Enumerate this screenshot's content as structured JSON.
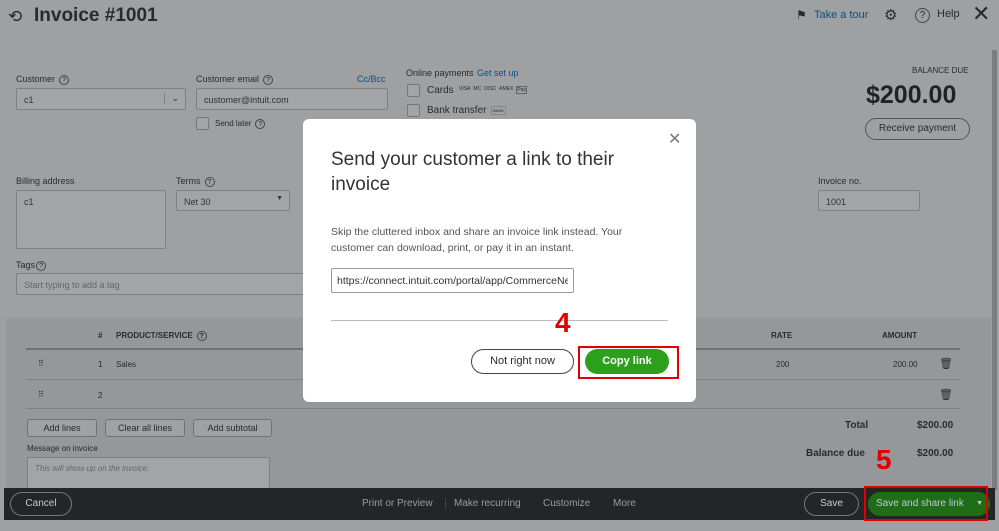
{
  "header": {
    "title": "Invoice #1001",
    "take_tour": "Take a tour",
    "help": "Help"
  },
  "form": {
    "customer_label": "Customer",
    "customer_value": "c1",
    "email_label": "Customer email",
    "email_value": "customer@intuit.com",
    "cc_bcc": "Cc/Bcc",
    "send_later": "Send later",
    "online_payments": "Online payments",
    "get_set_up": "Get set up",
    "cards": "Cards",
    "bank_transfer": "Bank transfer",
    "bank_badge": "BANK",
    "card_badges": [
      "VISA",
      "MC",
      "DISC",
      "AMEX",
      "Pay"
    ],
    "balance_due_label": "BALANCE DUE",
    "balance_due_amount": "$200.00",
    "receive_payment": "Receive payment",
    "billing_label": "Billing address",
    "billing_value": "c1",
    "terms_label": "Terms",
    "terms_value": "Net 30",
    "invoice_no_label": "Invoice no.",
    "invoice_no_value": "1001",
    "tags_label": "Tags",
    "tags_placeholder": "Start typing to add a tag"
  },
  "table": {
    "headers": {
      "num": "#",
      "product": "PRODUCT/SERVICE",
      "rate": "RATE",
      "amount": "AMOUNT"
    },
    "rows": [
      {
        "num": "1",
        "product": "Sales",
        "rate": "200",
        "amount": "200.00"
      },
      {
        "num": "2",
        "product": "",
        "rate": "",
        "amount": ""
      }
    ],
    "add_lines": "Add lines",
    "clear_all": "Clear all lines",
    "add_subtotal": "Add subtotal",
    "total_label": "Total",
    "total_value": "$200.00",
    "balance_label": "Balance due",
    "balance_value": "$200.00",
    "message_label": "Message on invoice",
    "message_placeholder": "This will show up on the invoice."
  },
  "footer": {
    "cancel": "Cancel",
    "print": "Print or Preview",
    "recurring": "Make recurring",
    "customize": "Customize",
    "more": "More",
    "save": "Save",
    "save_share": "Save and share link"
  },
  "modal": {
    "title": "Send your customer a link to their invoice",
    "body": "Skip the cluttered inbox and share an invoice link instead. Your customer can download, print, or pay it in an instant.",
    "link": "https://connect.intuit.com/portal/app/CommerceNetwork",
    "not_now": "Not right now",
    "copy": "Copy link"
  },
  "annotations": {
    "step4": "4",
    "step5": "5"
  },
  "colors": {
    "green": "#2ca01c",
    "red": "#e00000",
    "link": "#0b6fb0"
  }
}
